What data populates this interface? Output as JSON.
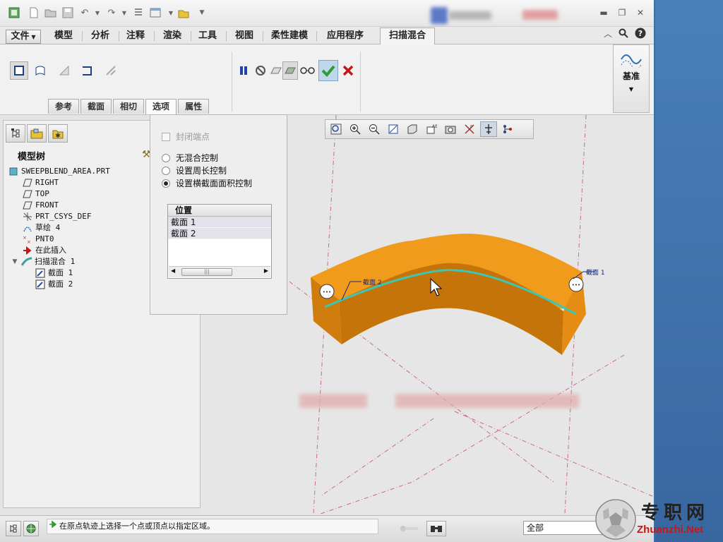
{
  "quick_access": {
    "icons": [
      "app-icon",
      "new-icon",
      "open-icon",
      "save-icon",
      "undo-icon",
      "redo-icon",
      "regenerate-icon",
      "windows-icon",
      "close-window-icon",
      "more-icon"
    ]
  },
  "ribbon": {
    "tabs": [
      {
        "label": "文件"
      },
      {
        "label": "模型"
      },
      {
        "label": "分析"
      },
      {
        "label": "注释"
      },
      {
        "label": "渲染"
      },
      {
        "label": "工具"
      },
      {
        "label": "视图"
      },
      {
        "label": "柔性建模"
      },
      {
        "label": "应用程序"
      },
      {
        "label": "扫描混合"
      }
    ],
    "active_tab": "扫描混合",
    "subtabs": [
      {
        "label": "参考"
      },
      {
        "label": "截面"
      },
      {
        "label": "相切"
      },
      {
        "label": "选项"
      },
      {
        "label": "属性"
      }
    ],
    "active_subtab": "选项",
    "datum_label": "基准"
  },
  "model_tree": {
    "title": "模型树",
    "items": [
      {
        "label": "SWEEPBLEND_AREA.PRT",
        "icon": "part-icon"
      },
      {
        "label": "RIGHT",
        "icon": "datum-plane-icon"
      },
      {
        "label": "TOP",
        "icon": "datum-plane-icon"
      },
      {
        "label": "FRONT",
        "icon": "datum-plane-icon"
      },
      {
        "label": "PRT_CSYS_DEF",
        "icon": "csys-icon"
      },
      {
        "label": "草绘 4",
        "icon": "sketch-icon"
      },
      {
        "label": "PNT0",
        "icon": "point-icon"
      },
      {
        "label": "在此插入",
        "icon": "insert-arrow-icon"
      },
      {
        "label": "扫描混合 1",
        "icon": "sweep-blend-icon"
      },
      {
        "label": "截面 1",
        "icon": "section-icon"
      },
      {
        "label": "截面 2",
        "icon": "section-icon"
      }
    ]
  },
  "options_panel": {
    "closed_ends_label": "封闭端点",
    "closed_ends_checked": false,
    "radio_options": [
      {
        "label": "无混合控制",
        "selected": false
      },
      {
        "label": "设置周长控制",
        "selected": false
      },
      {
        "label": "设置横截面面积控制",
        "selected": true
      }
    ],
    "table": {
      "header": "位置",
      "rows": [
        "截面 1",
        "截面 2"
      ]
    }
  },
  "graphics": {
    "labels": {
      "section1": "截面 1",
      "section2": "截面 2"
    },
    "toolbar_icons": [
      "refit-icon",
      "zoom-in-icon",
      "zoom-out-icon",
      "repaint-icon",
      "display-style-icon",
      "saved-orientations-icon",
      "view-manager-icon",
      "datum-display-icon",
      "annotation-display-icon",
      "csys-display-icon",
      "spin-center-icon"
    ]
  },
  "status_bar": {
    "message": "在原点轨迹上选择一个点或顶点以指定区域。",
    "filter_value": "全部"
  },
  "watermark": {
    "text_cn": "专职网",
    "text_en": "Zhuanzhi.Net"
  },
  "colors": {
    "solid": "#e58a10",
    "trajectory": "#3fc6b3",
    "accept": "#2c9e2c",
    "cancel": "#c41818"
  }
}
